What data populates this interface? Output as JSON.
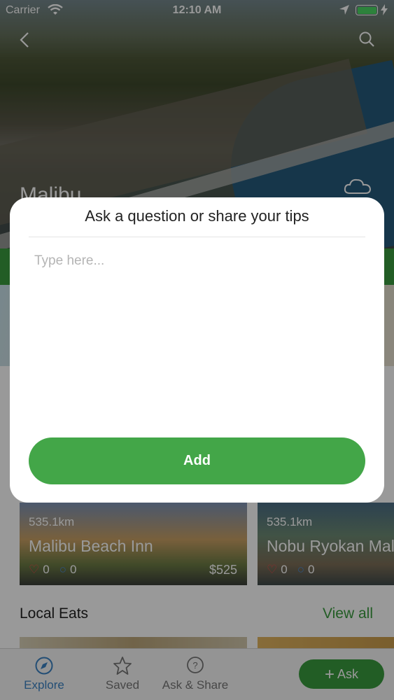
{
  "status_bar": {
    "carrier": "Carrier",
    "time": "12:10 AM"
  },
  "hero": {
    "title": "Malibu"
  },
  "cards": [
    {
      "distance": "535.1km",
      "name": "Malibu Beach Inn",
      "likes": "0",
      "comments": "0",
      "price": "$525"
    },
    {
      "distance": "535.1km",
      "name": "Nobu Ryokan Malibu",
      "likes": "0",
      "comments": "0",
      "price": ""
    }
  ],
  "local_eats": {
    "title": "Local Eats",
    "view_all": "View all"
  },
  "tabs": {
    "explore": "Explore",
    "saved": "Saved",
    "ask_share": "Ask & Share",
    "ask_button": "Ask"
  },
  "modal": {
    "title": "Ask a question or share your tips",
    "placeholder": "Type here...",
    "add_label": "Add"
  },
  "colors": {
    "accent_green": "#43a648",
    "tab_active": "#3b82c4"
  },
  "icons": [
    "back-chevron-icon",
    "search-icon",
    "cloud-icon",
    "compass-icon",
    "star-icon",
    "question-bubble-icon",
    "plus-icon",
    "heart-icon",
    "comment-icon"
  ]
}
